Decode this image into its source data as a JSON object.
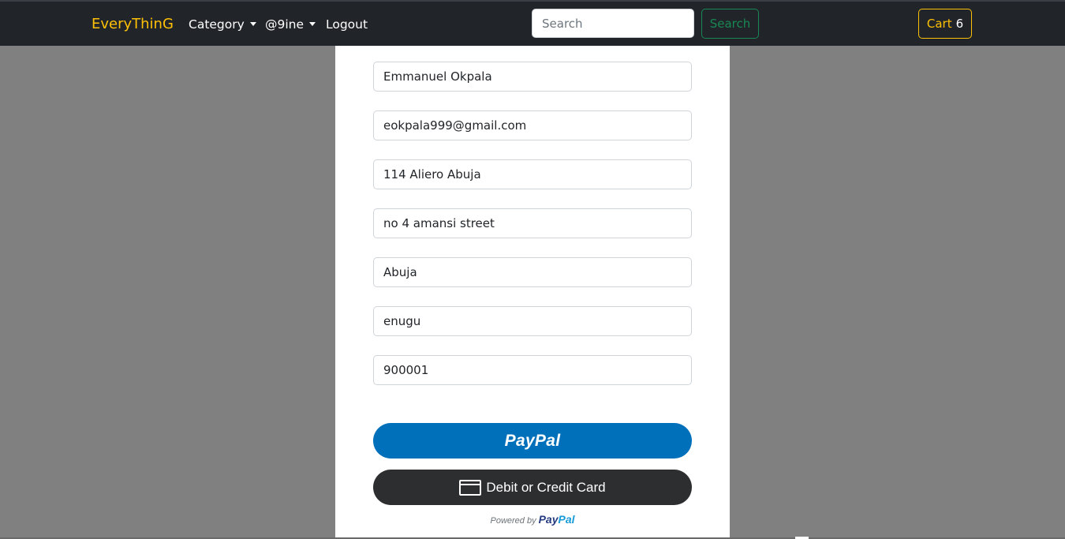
{
  "navbar": {
    "brand": "EveryThinG",
    "category_label": "Category",
    "user_label": "@9ine",
    "logout_label": "Logout",
    "search_placeholder": "Search",
    "search_button": "Search",
    "cart_label": "Cart",
    "cart_count": "6"
  },
  "form": {
    "fields": [
      {
        "name": "name",
        "value": "Emmanuel Okpala"
      },
      {
        "name": "email",
        "value": "eokpala999@gmail.com"
      },
      {
        "name": "address",
        "value": "114 Aliero Abuja"
      },
      {
        "name": "address2",
        "value": "no 4 amansi street"
      },
      {
        "name": "city",
        "value": "Abuja"
      },
      {
        "name": "state",
        "value": "enugu"
      },
      {
        "name": "zip",
        "value": "900001"
      }
    ]
  },
  "payment": {
    "paypal_button": "PayPal",
    "card_button": "Debit or Credit Card",
    "card_icon": "credit-card-icon",
    "powered_by": "Powered by",
    "powered_logo_pay": "Pay",
    "powered_logo_pal": "Pal"
  },
  "colors": {
    "navbar_bg": "#212529",
    "brand": "#ffc107",
    "search_button": "#198754",
    "paypal_blue": "#0070ba",
    "card_button_bg": "#2c2e2f",
    "backdrop": "#808080"
  }
}
